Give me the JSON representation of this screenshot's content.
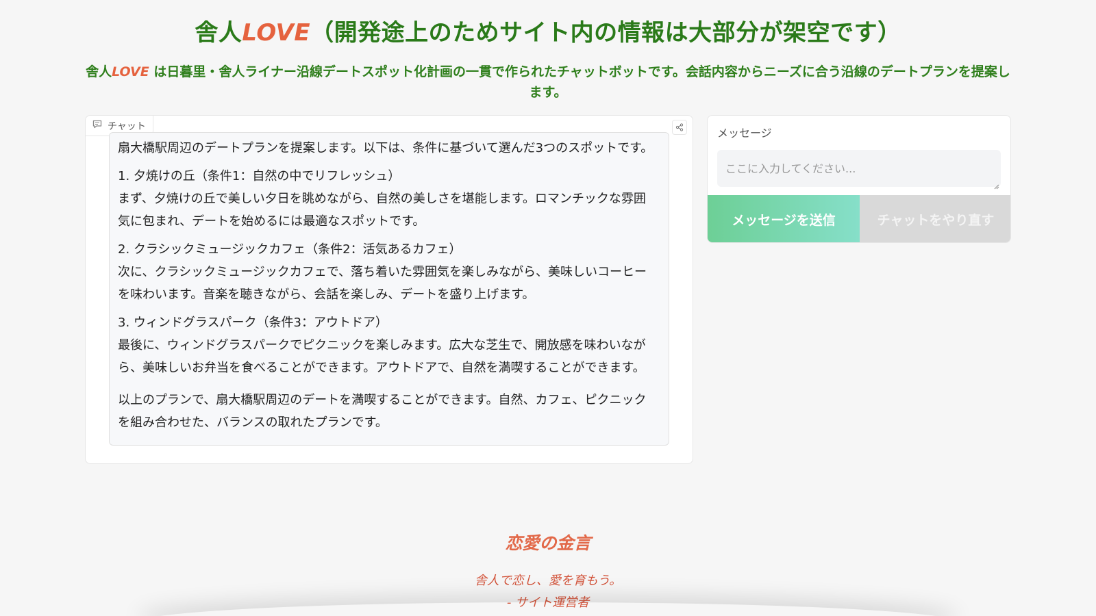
{
  "header": {
    "title_prefix": "舎人",
    "title_brand": "LOVE",
    "title_suffix": "（開発途上のためサイト内の情報は大部分が架空です）",
    "subtitle_prefix": "舎人",
    "subtitle_brand": "LOVE",
    "subtitle_suffix": " は日暮里・舎人ライナー沿線デートスポット化計画の一貫で作られたチャットボットです。会話内容からニーズに合う沿線のデートプランを提案します。"
  },
  "chat": {
    "label": "チャット",
    "label_icon": "chat-bubble-icon",
    "share_icon": "share-icon",
    "message": {
      "intro": "扇大橋駅周辺のデートプランを提案します。以下は、条件に基づいて選んだ3つのスポットです。",
      "item1_title": "1. 夕焼けの丘（条件1：自然の中でリフレッシュ）",
      "item1_body": "まず、夕焼けの丘で美しい夕日を眺めながら、自然の美しさを堪能します。ロマンチックな雰囲気に包まれ、デートを始めるには最適なスポットです。",
      "item2_title": "2. クラシックミュージックカフェ（条件2：活気あるカフェ）",
      "item2_body": "次に、クラシックミュージックカフェで、落ち着いた雰囲気を楽しみながら、美味しいコーヒーを味わいます。音楽を聴きながら、会話を楽しみ、デートを盛り上げます。",
      "item3_title": "3. ウィンドグラスパーク（条件3：アウトドア）",
      "item3_body": "最後に、ウィンドグラスパークでピクニックを楽しみます。広大な芝生で、開放感を味わいながら、美味しいお弁当を食べることができます。アウトドアで、自然を満喫することができます。",
      "conclusion": "以上のプランで、扇大橋駅周辺のデートを満喫することができます。自然、カフェ、ピクニックを組み合わせた、バランスの取れたプランです。"
    }
  },
  "input_panel": {
    "label": "メッセージ",
    "placeholder": "ここに入力してください...",
    "value": "",
    "send_button": "メッセージを送信",
    "reset_button": "チャットをやり直す"
  },
  "quote": {
    "title": "恋愛の金言",
    "text": "舎人で恋し、愛を育もう。",
    "author": "- サイト運営者"
  },
  "colors": {
    "title_green": "#2a7a19",
    "brand_orange": "#e5623e",
    "send_gradient_start": "#6dcf96",
    "send_gradient_end": "#86dfc9",
    "reset_gray": "#d9d9d9",
    "quote_red": "#d3553c"
  }
}
